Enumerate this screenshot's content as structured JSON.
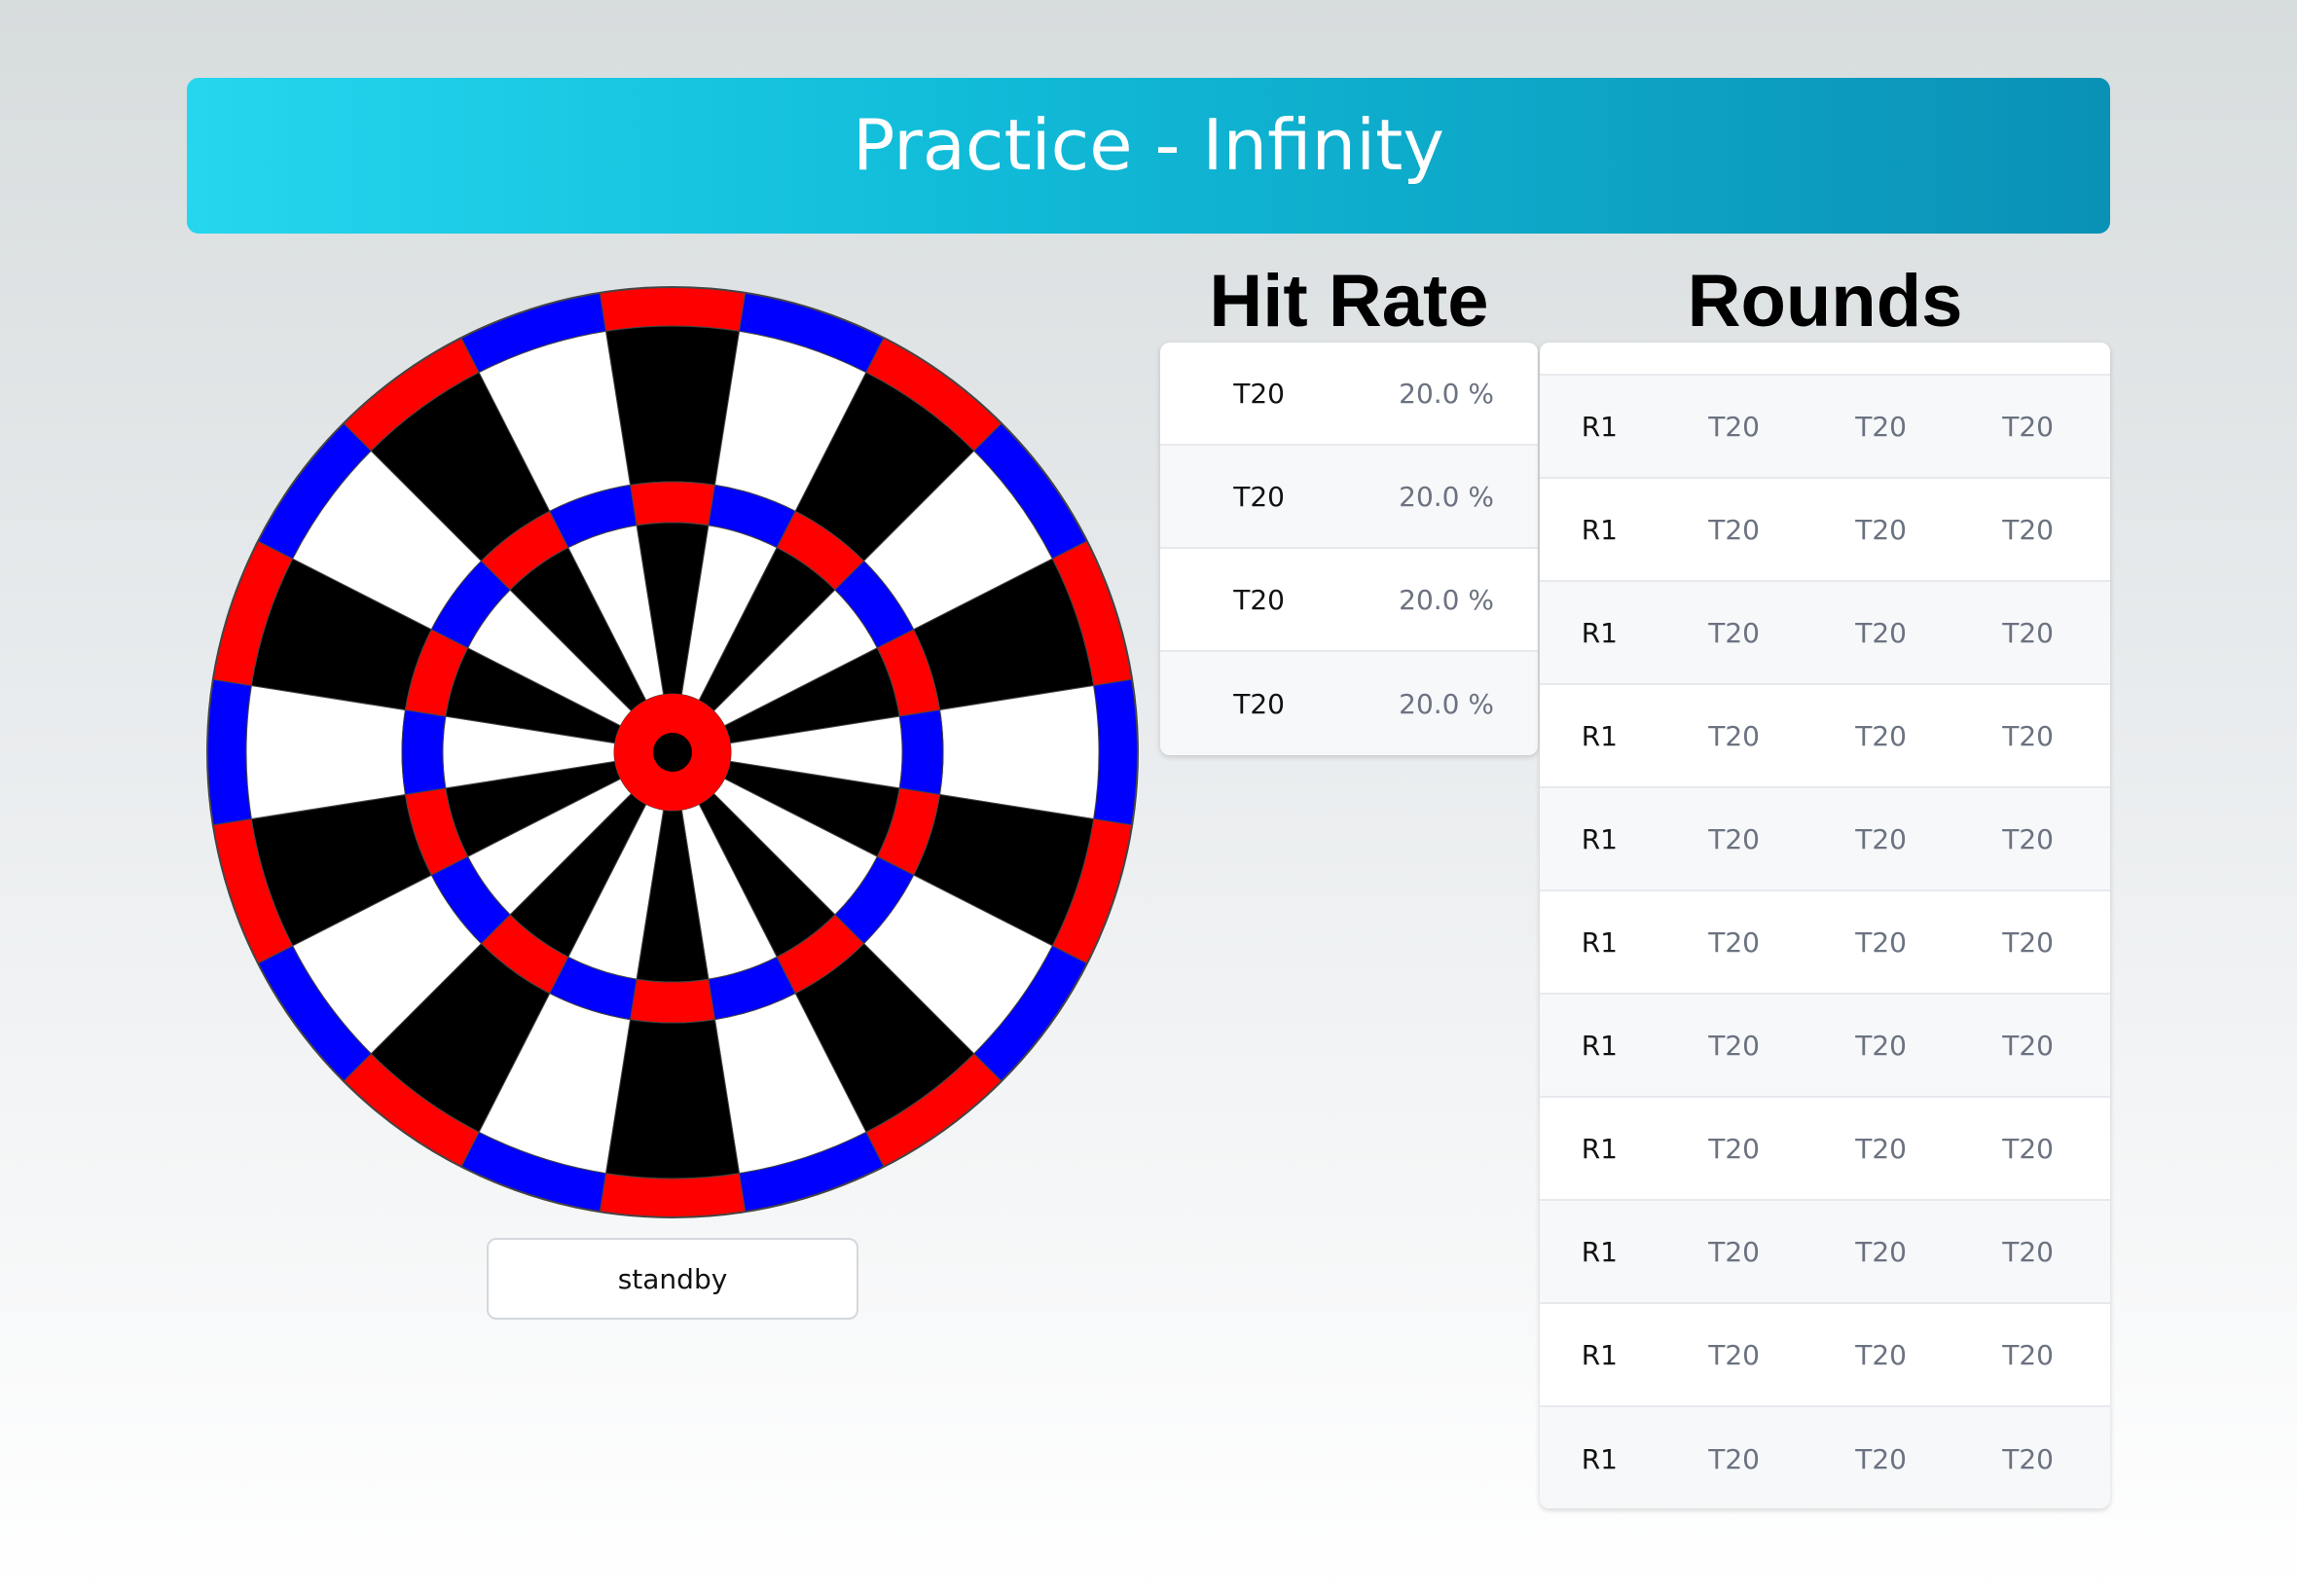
{
  "header": {
    "title": "Practice - Infinity"
  },
  "dartboard": {
    "colors": {
      "outline": "#444444",
      "black": "#000000",
      "white": "#ffffff",
      "red": "#ff0000",
      "blue": "#0000ff"
    }
  },
  "status": {
    "text": "standby"
  },
  "hit_rate": {
    "title": "Hit Rate",
    "rows": [
      {
        "name": "T20",
        "value": "20.0 %"
      },
      {
        "name": "T20",
        "value": "20.0 %"
      },
      {
        "name": "T20",
        "value": "20.0 %"
      },
      {
        "name": "T20",
        "value": "20.0 %"
      }
    ]
  },
  "rounds": {
    "title": "Rounds",
    "rows": [
      {
        "round": "R1",
        "throws": [
          "T20",
          "T20",
          "T20"
        ]
      },
      {
        "round": "R1",
        "throws": [
          "T20",
          "T20",
          "T20"
        ]
      },
      {
        "round": "R1",
        "throws": [
          "T20",
          "T20",
          "T20"
        ]
      },
      {
        "round": "R1",
        "throws": [
          "T20",
          "T20",
          "T20"
        ]
      },
      {
        "round": "R1",
        "throws": [
          "T20",
          "T20",
          "T20"
        ]
      },
      {
        "round": "R1",
        "throws": [
          "T20",
          "T20",
          "T20"
        ]
      },
      {
        "round": "R1",
        "throws": [
          "T20",
          "T20",
          "T20"
        ]
      },
      {
        "round": "R1",
        "throws": [
          "T20",
          "T20",
          "T20"
        ]
      },
      {
        "round": "R1",
        "throws": [
          "T20",
          "T20",
          "T20"
        ]
      },
      {
        "round": "R1",
        "throws": [
          "T20",
          "T20",
          "T20"
        ]
      },
      {
        "round": "R1",
        "throws": [
          "T20",
          "T20",
          "T20"
        ]
      }
    ]
  }
}
